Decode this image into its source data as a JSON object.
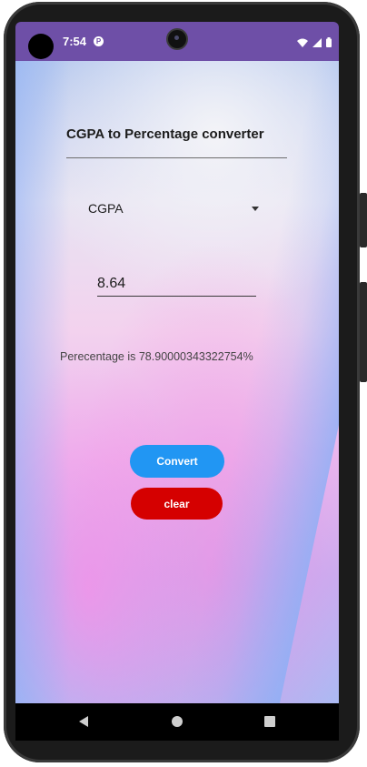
{
  "status_bar": {
    "time": "7:54",
    "app_icon_letter": "P",
    "icons": [
      "wifi-icon",
      "signal-icon",
      "battery-icon"
    ]
  },
  "app": {
    "title": "CGPA to Percentage converter",
    "spinner": {
      "selected": "CGPA"
    },
    "input": {
      "value": "8.64"
    },
    "result": "Perecentage is 78.90000343322754%",
    "buttons": {
      "convert": "Convert",
      "clear": "clear"
    }
  },
  "colors": {
    "status_bar": "#6e4fa7",
    "convert_button": "#2196f3",
    "clear_button": "#d50000"
  },
  "nav_bar": {
    "icons": [
      "back-icon",
      "home-icon",
      "recents-icon"
    ]
  }
}
